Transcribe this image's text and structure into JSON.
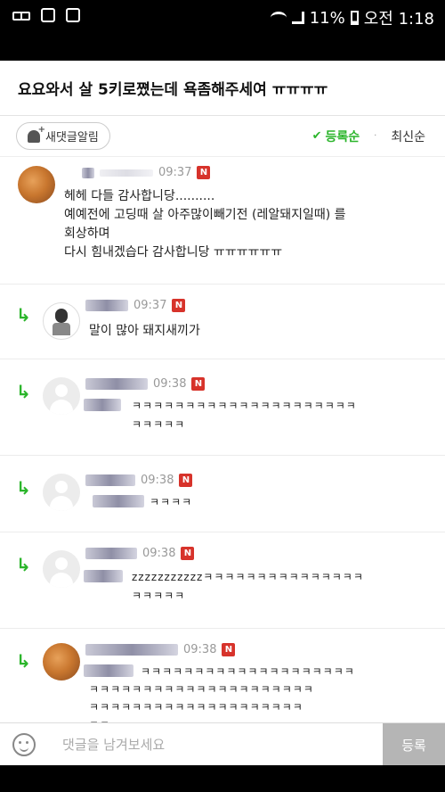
{
  "status_bar": {
    "battery": "11%",
    "time": "오전 1:18",
    "icons": [
      "glasses-icon",
      "image-icon",
      "doc-icon",
      "wifi-icon",
      "signal-icon",
      "battery-icon"
    ]
  },
  "post": {
    "title": "요요와서 살 5키로쪘는데 욕좀해주세여 ㅠㅠㅠㅠ"
  },
  "toolbar": {
    "alert_label": "새댓글알림",
    "sort_active": "등록순",
    "sort_other": "최신순",
    "accent_color": "#2bb52b"
  },
  "comments": [
    {
      "time": "09:37",
      "badge": "N",
      "avatar": "food",
      "is_reply": false,
      "text": "헤헤 다들 감사합니당..........\n예예전에 고딩때 살 아주많이빼기전 (레알돼지일때) 를\n회상하며\n다시 힘내겠습다 감사합니당 ㅠㅠㅠㅠㅠㅠ"
    },
    {
      "time": "09:37",
      "badge": "N",
      "avatar": "character",
      "is_reply": true,
      "text": "말이 많아 돼지새끼가"
    },
    {
      "time": "09:38",
      "badge": "N",
      "avatar": "default",
      "is_reply": true,
      "text": "ㅋㅋㅋㅋㅋㅋㅋㅋㅋㅋㅋㅋㅋㅋㅋㅋㅋㅋㅋㅋㅋ\nㅋㅋㅋㅋㅋ"
    },
    {
      "time": "09:38",
      "badge": "N",
      "avatar": "default",
      "is_reply": true,
      "text": "ㅋㅋㅋㅋ"
    },
    {
      "time": "09:38",
      "badge": "N",
      "avatar": "default",
      "is_reply": true,
      "text": "zzzzzzzzzzzㅋㅋㅋㅋㅋㅋㅋㅋㅋㅋㅋㅋㅋㅋㅋ\nㅋㅋㅋㅋㅋ"
    },
    {
      "time": "09:38",
      "badge": "N",
      "avatar": "food",
      "is_reply": true,
      "text": "ㅋㅋㅋㅋㅋㅋㅋㅋㅋㅋㅋㅋㅋㅋㅋㅋㅋㅋㅋㅋ\nㅋㅋㅋㅋㅋㅋㅋㅋㅋㅋㅋㅋㅋㅋㅋㅋㅋㅋㅋㅋㅋ\nㅋㅋㅋㅋㅋㅋㅋㅋㅋㅋㅋㅋㅋㅋㅋㅋㅋㅋㅋㅋ\nㅋㅋ"
    }
  ],
  "input_bar": {
    "placeholder": "댓글을 남겨보세요",
    "submit_label": "등록"
  }
}
